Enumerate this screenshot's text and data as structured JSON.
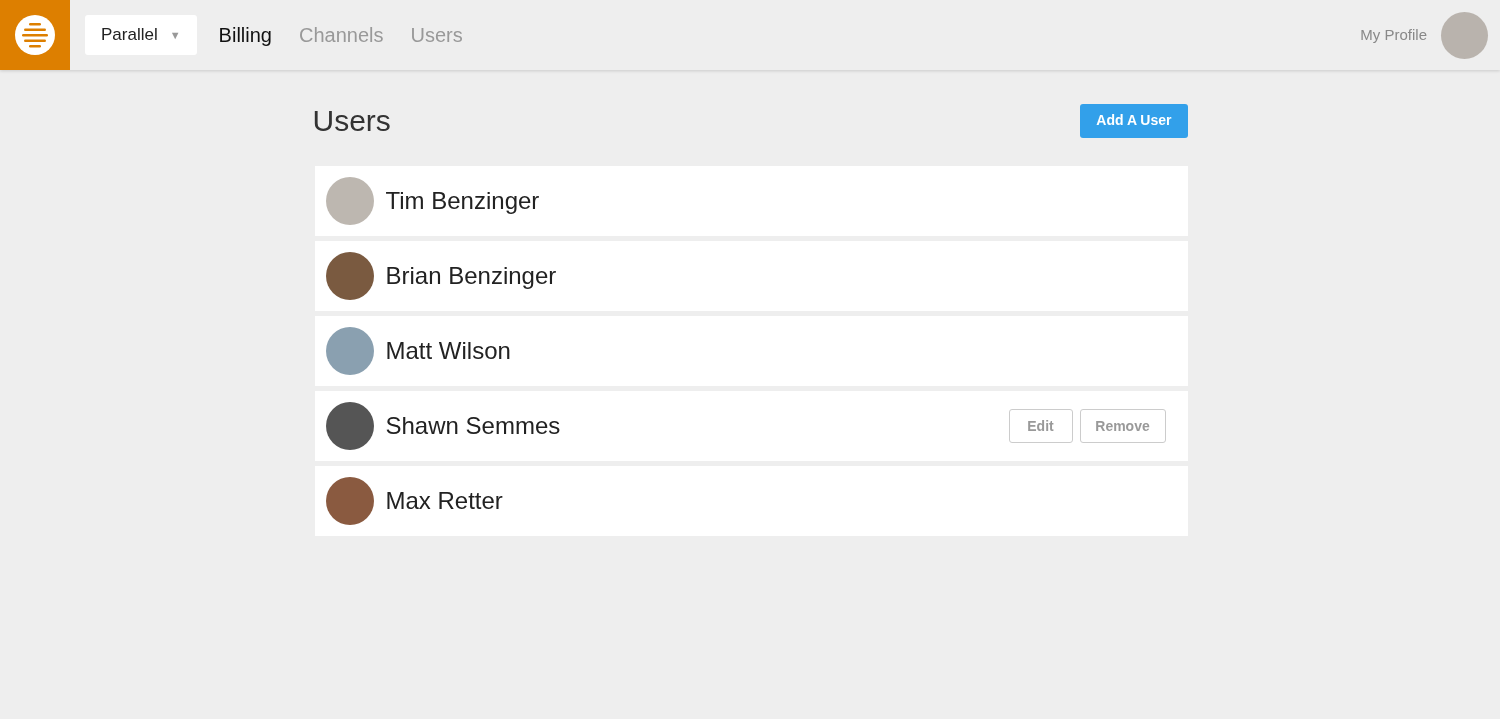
{
  "header": {
    "workspace": {
      "label": "Parallel",
      "caret": "▼"
    },
    "nav": [
      {
        "label": "Billing",
        "selected": true
      },
      {
        "label": "Channels",
        "selected": false
      },
      {
        "label": "Users",
        "selected": false
      }
    ],
    "profile_link": "My Profile"
  },
  "page": {
    "title": "Users",
    "add_button": "Add A User"
  },
  "users": [
    {
      "name": "Tim Benzinger"
    },
    {
      "name": "Brian Benzinger"
    },
    {
      "name": "Matt Wilson"
    },
    {
      "name": "Shawn Semmes",
      "actions": [
        "Edit",
        "Remove"
      ]
    },
    {
      "name": "Max Retter"
    }
  ]
}
